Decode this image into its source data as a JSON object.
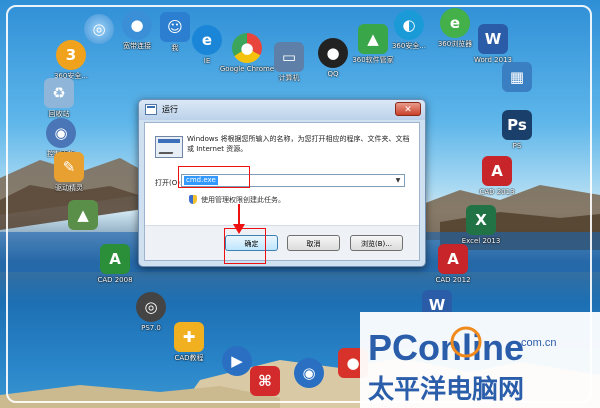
{
  "desktop": {
    "icons": [
      {
        "label": "360安全...",
        "icon": "360-icon",
        "color": "#f1a21d"
      },
      {
        "label": "宽带连接",
        "icon": "network-globe-icon",
        "color": "#3a8fd6"
      },
      {
        "label": "我",
        "icon": "user-icon",
        "color": "#2c7fd0"
      },
      {
        "label": "IE",
        "icon": "ie-icon",
        "color": "#1b86d8"
      },
      {
        "label": "Google Chrome",
        "icon": "chrome-icon",
        "color": "#e8453c"
      },
      {
        "label": "计算机",
        "icon": "computer-icon",
        "color": "#5d7fa8"
      },
      {
        "label": "QQ",
        "icon": "qq-penguin-icon",
        "color": "#222222"
      },
      {
        "label": "360软件管家",
        "icon": "software-manager-icon",
        "color": "#3aa64a"
      },
      {
        "label": "回收站",
        "icon": "recycle-bin-icon",
        "color": "#8fb6d8"
      },
      {
        "label": "360安全...",
        "icon": "360-guard-icon",
        "color": "#1a9bd8"
      },
      {
        "label": "360浏览器",
        "icon": "browser-360-icon",
        "color": "#43b049"
      },
      {
        "label": "Word 2013",
        "icon": "word-icon",
        "color": "#2b5ca8"
      },
      {
        "label": "控制面板",
        "icon": "control-panel-icon",
        "color": "#4a76b8"
      },
      {
        "label": "驱动精灵",
        "icon": "driver-icon",
        "color": "#e8a030"
      },
      {
        "label": "PS",
        "icon": "photoshop-icon",
        "color": "#1b3f6b"
      },
      {
        "label": "CAD 2013",
        "icon": "cad-icon",
        "color": "#c8252b"
      },
      {
        "label": "Excel 2013",
        "icon": "excel-icon",
        "color": "#217346"
      },
      {
        "label": "CAD 2008",
        "icon": "cad-2008-icon",
        "color": "#2b8f3a"
      },
      {
        "label": "CAD 2012",
        "icon": "cad-2012-icon",
        "color": "#c8252b"
      },
      {
        "label": "PS7.0",
        "icon": "ps7-icon",
        "color": "#444444"
      },
      {
        "label": "CAD教程",
        "icon": "cad-tutorial-icon",
        "color": "#f0b020"
      },
      {
        "label": "Adobe Reader",
        "icon": "pdf-icon",
        "color": "#d32b2b"
      },
      {
        "label": "",
        "icon": "media-player-icon",
        "color": "#2a6fc2"
      },
      {
        "label": "",
        "icon": "word-shortcut-icon",
        "color": "#2b5ca8"
      },
      {
        "label": "",
        "icon": "app-icon",
        "color": "#d8332a"
      }
    ]
  },
  "run_dialog": {
    "title": "运行",
    "close_glyph": "✕",
    "description": "Windows 将根据您所输入的名称，为您打开相应的程序、文件夹、文档或 Internet 资源。",
    "open_label": "打开(O):",
    "open_value": "cmd.exe",
    "admin_note": "使用管理权限创建此任务。",
    "buttons": {
      "ok": "确定",
      "cancel": "取消",
      "browse": "浏览(B)..."
    }
  },
  "watermark": {
    "brand": "PConline",
    "domain": ".com.cn",
    "chinese": "太平洋电脑网"
  }
}
